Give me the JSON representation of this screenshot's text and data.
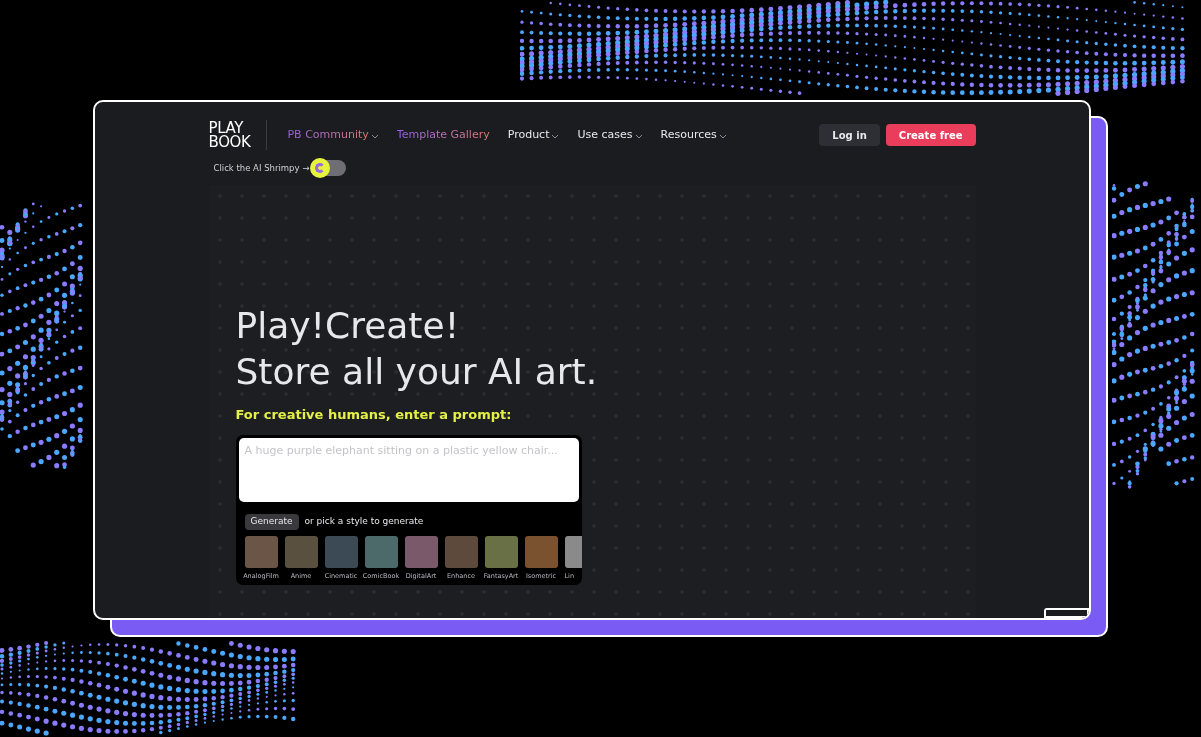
{
  "logo": {
    "line_1": "PLAY",
    "line_2": "BOOK"
  },
  "nav": [
    {
      "label": "PB Community",
      "kind": "gradient",
      "dropdown": true
    },
    {
      "label": "Template Gallery",
      "kind": "gradient",
      "dropdown": false
    },
    {
      "label": "Product",
      "kind": "plain",
      "dropdown": true
    },
    {
      "label": "Use cases",
      "kind": "plain",
      "dropdown": true
    },
    {
      "label": "Resources",
      "kind": "plain",
      "dropdown": true
    }
  ],
  "actions": [
    {
      "label": "Log in",
      "kind": "secondary"
    },
    {
      "label": "Create free",
      "kind": "primary"
    }
  ],
  "shrimpy": {
    "label": "Click the AI Shrimpy →",
    "on": false
  },
  "hero": {
    "lines": [
      "Play!Create!",
      "Store all your AI art."
    ],
    "subtitle": "For creative humans, enter a prompt:"
  },
  "prompt": {
    "placeholder": "A huge purple elephant sitting on a plastic yellow chair...",
    "button": "Generate",
    "hint": "or pick a style to generate"
  },
  "styles": [
    {
      "label": "AnalogFilm",
      "color": "#6b5546"
    },
    {
      "label": "Anime",
      "color": "#5a5040"
    },
    {
      "label": "Cinematic",
      "color": "#3c4a55"
    },
    {
      "label": "ComicBook",
      "color": "#4d6a6a"
    },
    {
      "label": "DigitalArt",
      "color": "#7a5a6a"
    },
    {
      "label": "Enhance",
      "color": "#5e4a3c"
    },
    {
      "label": "FantasyArt",
      "color": "#6a7045"
    },
    {
      "label": "Isometric",
      "color": "#7a5230"
    },
    {
      "label": "Lin",
      "color": "#8a8a8a"
    }
  ]
}
